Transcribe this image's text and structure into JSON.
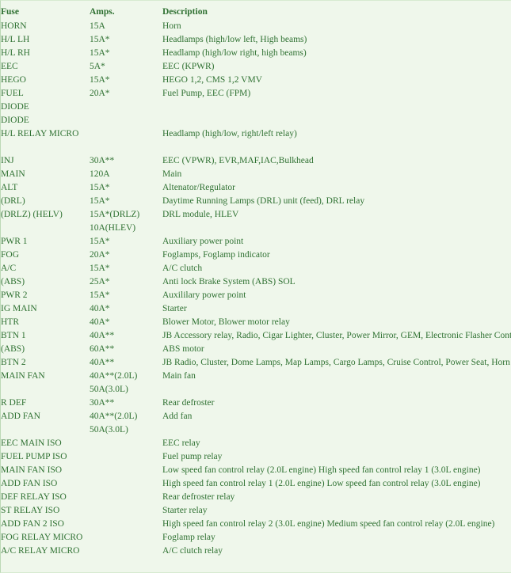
{
  "table": {
    "headers": {
      "fuse": "Fuse",
      "amps": "Amps.",
      "description": "Description"
    },
    "rows": [
      {
        "type": "row",
        "fuse": "HORN",
        "amps": "15A",
        "description": "Horn"
      },
      {
        "type": "row",
        "fuse": "H/L LH",
        "amps": "15A*",
        "description": "Headlamps (high/low left, High beams)"
      },
      {
        "type": "row",
        "fuse": "H/L RH",
        "amps": "15A*",
        "description": "Headlamp (high/low right, high beams)"
      },
      {
        "type": "row",
        "fuse": "EEC",
        "amps": "5A*",
        "description": "EEC (KPWR)"
      },
      {
        "type": "row",
        "fuse": "HEGO",
        "amps": "15A*",
        "description": "HEGO 1,2, CMS 1,2 VMV"
      },
      {
        "type": "row",
        "fuse": "FUEL",
        "amps": "20A*",
        "description": "Fuel Pump, EEC (FPM)"
      },
      {
        "type": "row",
        "fuse": "DIODE",
        "amps": "",
        "description": ""
      },
      {
        "type": "row",
        "fuse": "DIODE",
        "amps": "",
        "description": ""
      },
      {
        "type": "row",
        "fuse": "H/L RELAY MICRO",
        "amps": "",
        "description": "Headlamp (high/low, right/left relay)"
      },
      {
        "type": "spacer",
        "fuse": "",
        "amps": "",
        "description": ""
      },
      {
        "type": "row",
        "fuse": "INJ",
        "amps": "30A**",
        "description": "EEC (VPWR), EVR,MAF,IAC,Bulkhead"
      },
      {
        "type": "row",
        "fuse": "MAIN",
        "amps": "120A",
        "description": "Main"
      },
      {
        "type": "row",
        "fuse": "ALT",
        "amps": "15A*",
        "description": "Altenator/Regulator"
      },
      {
        "type": "row",
        "fuse": "(DRL)",
        "amps": "15A*",
        "description": "Daytime Running Lamps (DRL) unit (feed), DRL relay"
      },
      {
        "type": "row",
        "fuse": "(DRLZ) (HELV)",
        "amps": "15A*(DRLZ)",
        "description": "DRL module, HLEV"
      },
      {
        "type": "cont",
        "fuse": "",
        "amps": "10A(HLEV)",
        "description": ""
      },
      {
        "type": "row",
        "fuse": "PWR 1",
        "amps": "15A*",
        "description": "Auxiliary power point"
      },
      {
        "type": "row",
        "fuse": "FOG",
        "amps": "20A*",
        "description": "Foglamps, Foglamp indicator"
      },
      {
        "type": "row",
        "fuse": "A/C",
        "amps": "15A*",
        "description": "A/C clutch"
      },
      {
        "type": "row",
        "fuse": "(ABS)",
        "amps": "25A*",
        "description": "Anti lock Brake System (ABS)  SOL"
      },
      {
        "type": "row",
        "fuse": "PWR 2",
        "amps": "15A*",
        "description": "Auxililary power point"
      },
      {
        "type": "row",
        "fuse": "IG MAIN",
        "amps": "40A*",
        "description": "Starter"
      },
      {
        "type": "row",
        "fuse": "HTR",
        "amps": "40A*",
        "description": "Blower Motor, Blower motor relay"
      },
      {
        "type": "row",
        "fuse": "BTN 1",
        "amps": "40A**",
        "description": "JB Accessory relay, Radio, Cigar Lighter, Cluster, Power Mirror, GEM, Electronic Flasher Control"
      },
      {
        "type": "row",
        "fuse": "(ABS)",
        "amps": "60A**",
        "description": "ABS motor"
      },
      {
        "type": "row",
        "fuse": "BTN 2",
        "amps": "40A**",
        "description": "JB Radio, Cluster, Dome Lamps, Map Lamps, Cargo Lamps, Cruise Control, Power Seat, Horn"
      },
      {
        "type": "row",
        "fuse": "MAIN FAN",
        "amps": "40A**(2.0L)",
        "description": "Main fan"
      },
      {
        "type": "cont",
        "fuse": "",
        "amps": "50A(3.0L)",
        "description": ""
      },
      {
        "type": "row",
        "fuse": "R DEF",
        "amps": "30A**",
        "description": "Rear defroster"
      },
      {
        "type": "row",
        "fuse": "ADD FAN",
        "amps": "40A**(2.0L)",
        "description": "Add fan"
      },
      {
        "type": "cont",
        "fuse": "",
        "amps": "50A(3.0L)",
        "description": ""
      },
      {
        "type": "row",
        "fuse": "EEC MAIN ISO",
        "amps": "",
        "description": "EEC relay"
      },
      {
        "type": "row",
        "fuse": "FUEL PUMP ISO",
        "amps": "",
        "description": "Fuel pump relay"
      },
      {
        "type": "row",
        "fuse": "MAIN FAN ISO",
        "amps": "",
        "description": "Low speed fan control relay (2.0L engine) High speed fan control relay 1 (3.0L engine)"
      },
      {
        "type": "row",
        "fuse": "ADD FAN ISO",
        "amps": "",
        "description": "High speed fan control relay 1 (2.0L engine) Low speed fan control relay (3.0L engine)"
      },
      {
        "type": "row",
        "fuse": "DEF RELAY ISO",
        "amps": "",
        "description": "Rear defroster relay"
      },
      {
        "type": "row",
        "fuse": "ST RELAY ISO",
        "amps": "",
        "description": "Starter relay"
      },
      {
        "type": "row",
        "fuse": "ADD FAN 2 ISO",
        "amps": "",
        "description": "High speed fan control relay 2 (3.0L engine) Medium speed fan control relay (2.0L engine)"
      },
      {
        "type": "row",
        "fuse": "FOG RELAY MICRO",
        "amps": "",
        "description": "Foglamp relay"
      },
      {
        "type": "row",
        "fuse": "A/C RELAY MICRO",
        "amps": "",
        "description": "A/C clutch relay"
      }
    ]
  },
  "colors": {
    "background": "#eff7eb",
    "text": "#2f7132",
    "border": "#bcd9b6"
  }
}
